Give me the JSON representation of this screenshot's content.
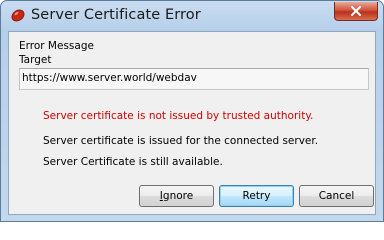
{
  "window": {
    "title": "Server Certificate Error"
  },
  "labels": {
    "error_message": "Error Message",
    "target": "Target"
  },
  "target_url": "https://www.server.world/webdav",
  "messages": [
    "Server certificate is not issued by trusted authority.",
    "Server certificate is issued for the connected server.",
    "Server Certificate is still available."
  ],
  "buttons": {
    "ignore_prefix": "",
    "ignore_mnemonic": "I",
    "ignore_rest": "gnore",
    "retry": "Retry",
    "cancel": "Cancel"
  },
  "icons": {
    "app": "red-oval-app-icon",
    "close": "close-x-icon"
  },
  "colors": {
    "error_text": "#d10000",
    "close_button": "#c7402b"
  }
}
